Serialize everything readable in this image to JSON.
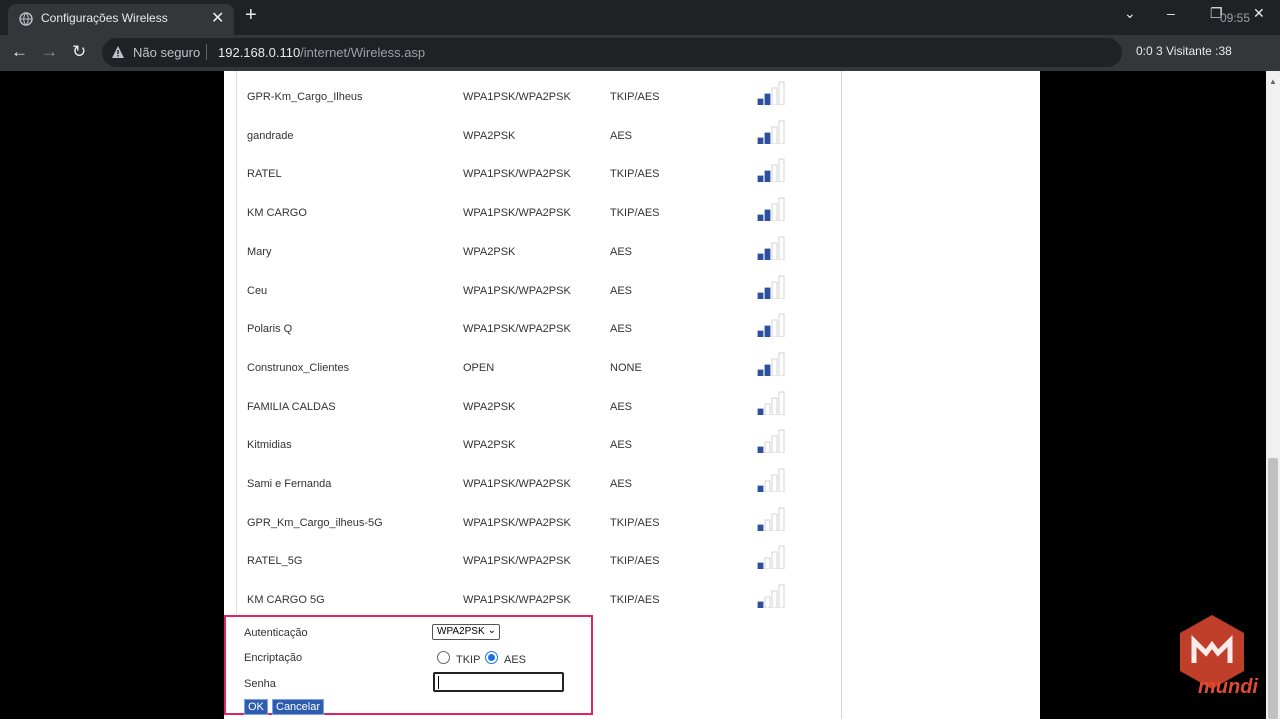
{
  "browser": {
    "tab_title": "Configurações Wireless",
    "tab_close": "✕",
    "new_tab": "+",
    "clock": "09:55",
    "not_secure": "Não seguro",
    "url_host": "192.168.0.110",
    "url_path": "/internet/Wireless.asp",
    "recording_overlay": "0:0 3 Visitante :38",
    "window_controls": {
      "dropdown": "⌄",
      "minimize": "–",
      "restore": "❐",
      "close": "✕"
    }
  },
  "networks": [
    {
      "ssid": "GPR-Km_Cargo_Ilheus",
      "auth": "WPA1PSK/WPA2PSK",
      "enc": "TKIP/AES",
      "signal": 2
    },
    {
      "ssid": "gandrade",
      "auth": "WPA2PSK",
      "enc": "AES",
      "signal": 2
    },
    {
      "ssid": "RATEL",
      "auth": "WPA1PSK/WPA2PSK",
      "enc": "TKIP/AES",
      "signal": 2
    },
    {
      "ssid": "KM CARGO",
      "auth": "WPA1PSK/WPA2PSK",
      "enc": "TKIP/AES",
      "signal": 2
    },
    {
      "ssid": "Mary",
      "auth": "WPA2PSK",
      "enc": "AES",
      "signal": 2
    },
    {
      "ssid": "Ceu",
      "auth": "WPA1PSK/WPA2PSK",
      "enc": "AES",
      "signal": 2
    },
    {
      "ssid": "Polaris Q",
      "auth": "WPA1PSK/WPA2PSK",
      "enc": "AES",
      "signal": 2
    },
    {
      "ssid": "Construnox_Clientes",
      "auth": "OPEN",
      "enc": "NONE",
      "signal": 2
    },
    {
      "ssid": "FAMILIA CALDAS",
      "auth": "WPA2PSK",
      "enc": "AES",
      "signal": 1
    },
    {
      "ssid": "Kitmidias",
      "auth": "WPA2PSK",
      "enc": "AES",
      "signal": 1
    },
    {
      "ssid": "Sami e Fernanda",
      "auth": "WPA1PSK/WPA2PSK",
      "enc": "AES",
      "signal": 1
    },
    {
      "ssid": "GPR_Km_Cargo_ilheus-5G",
      "auth": "WPA1PSK/WPA2PSK",
      "enc": "TKIP/AES",
      "signal": 1
    },
    {
      "ssid": "RATEL_5G",
      "auth": "WPA1PSK/WPA2PSK",
      "enc": "TKIP/AES",
      "signal": 1
    },
    {
      "ssid": "KM CARGO 5G",
      "auth": "WPA1PSK/WPA2PSK",
      "enc": "TKIP/AES",
      "signal": 1
    }
  ],
  "form": {
    "auth_label": "Autenticação",
    "auth_value": "WPA2PSK",
    "enc_label": "Encriptação",
    "tkip_label": "TKIP",
    "aes_label": "AES",
    "selected_enc": "AES",
    "password_label": "Senha",
    "password_value": "",
    "ok_label": "OK",
    "cancel_label": "Cancelar"
  },
  "watermark": {
    "text": "mundi",
    "color": "#e24a33"
  },
  "colors": {
    "highlight_box": "#e0245e",
    "button": "#2e5db0",
    "signal_active": "#2c4f9e"
  }
}
